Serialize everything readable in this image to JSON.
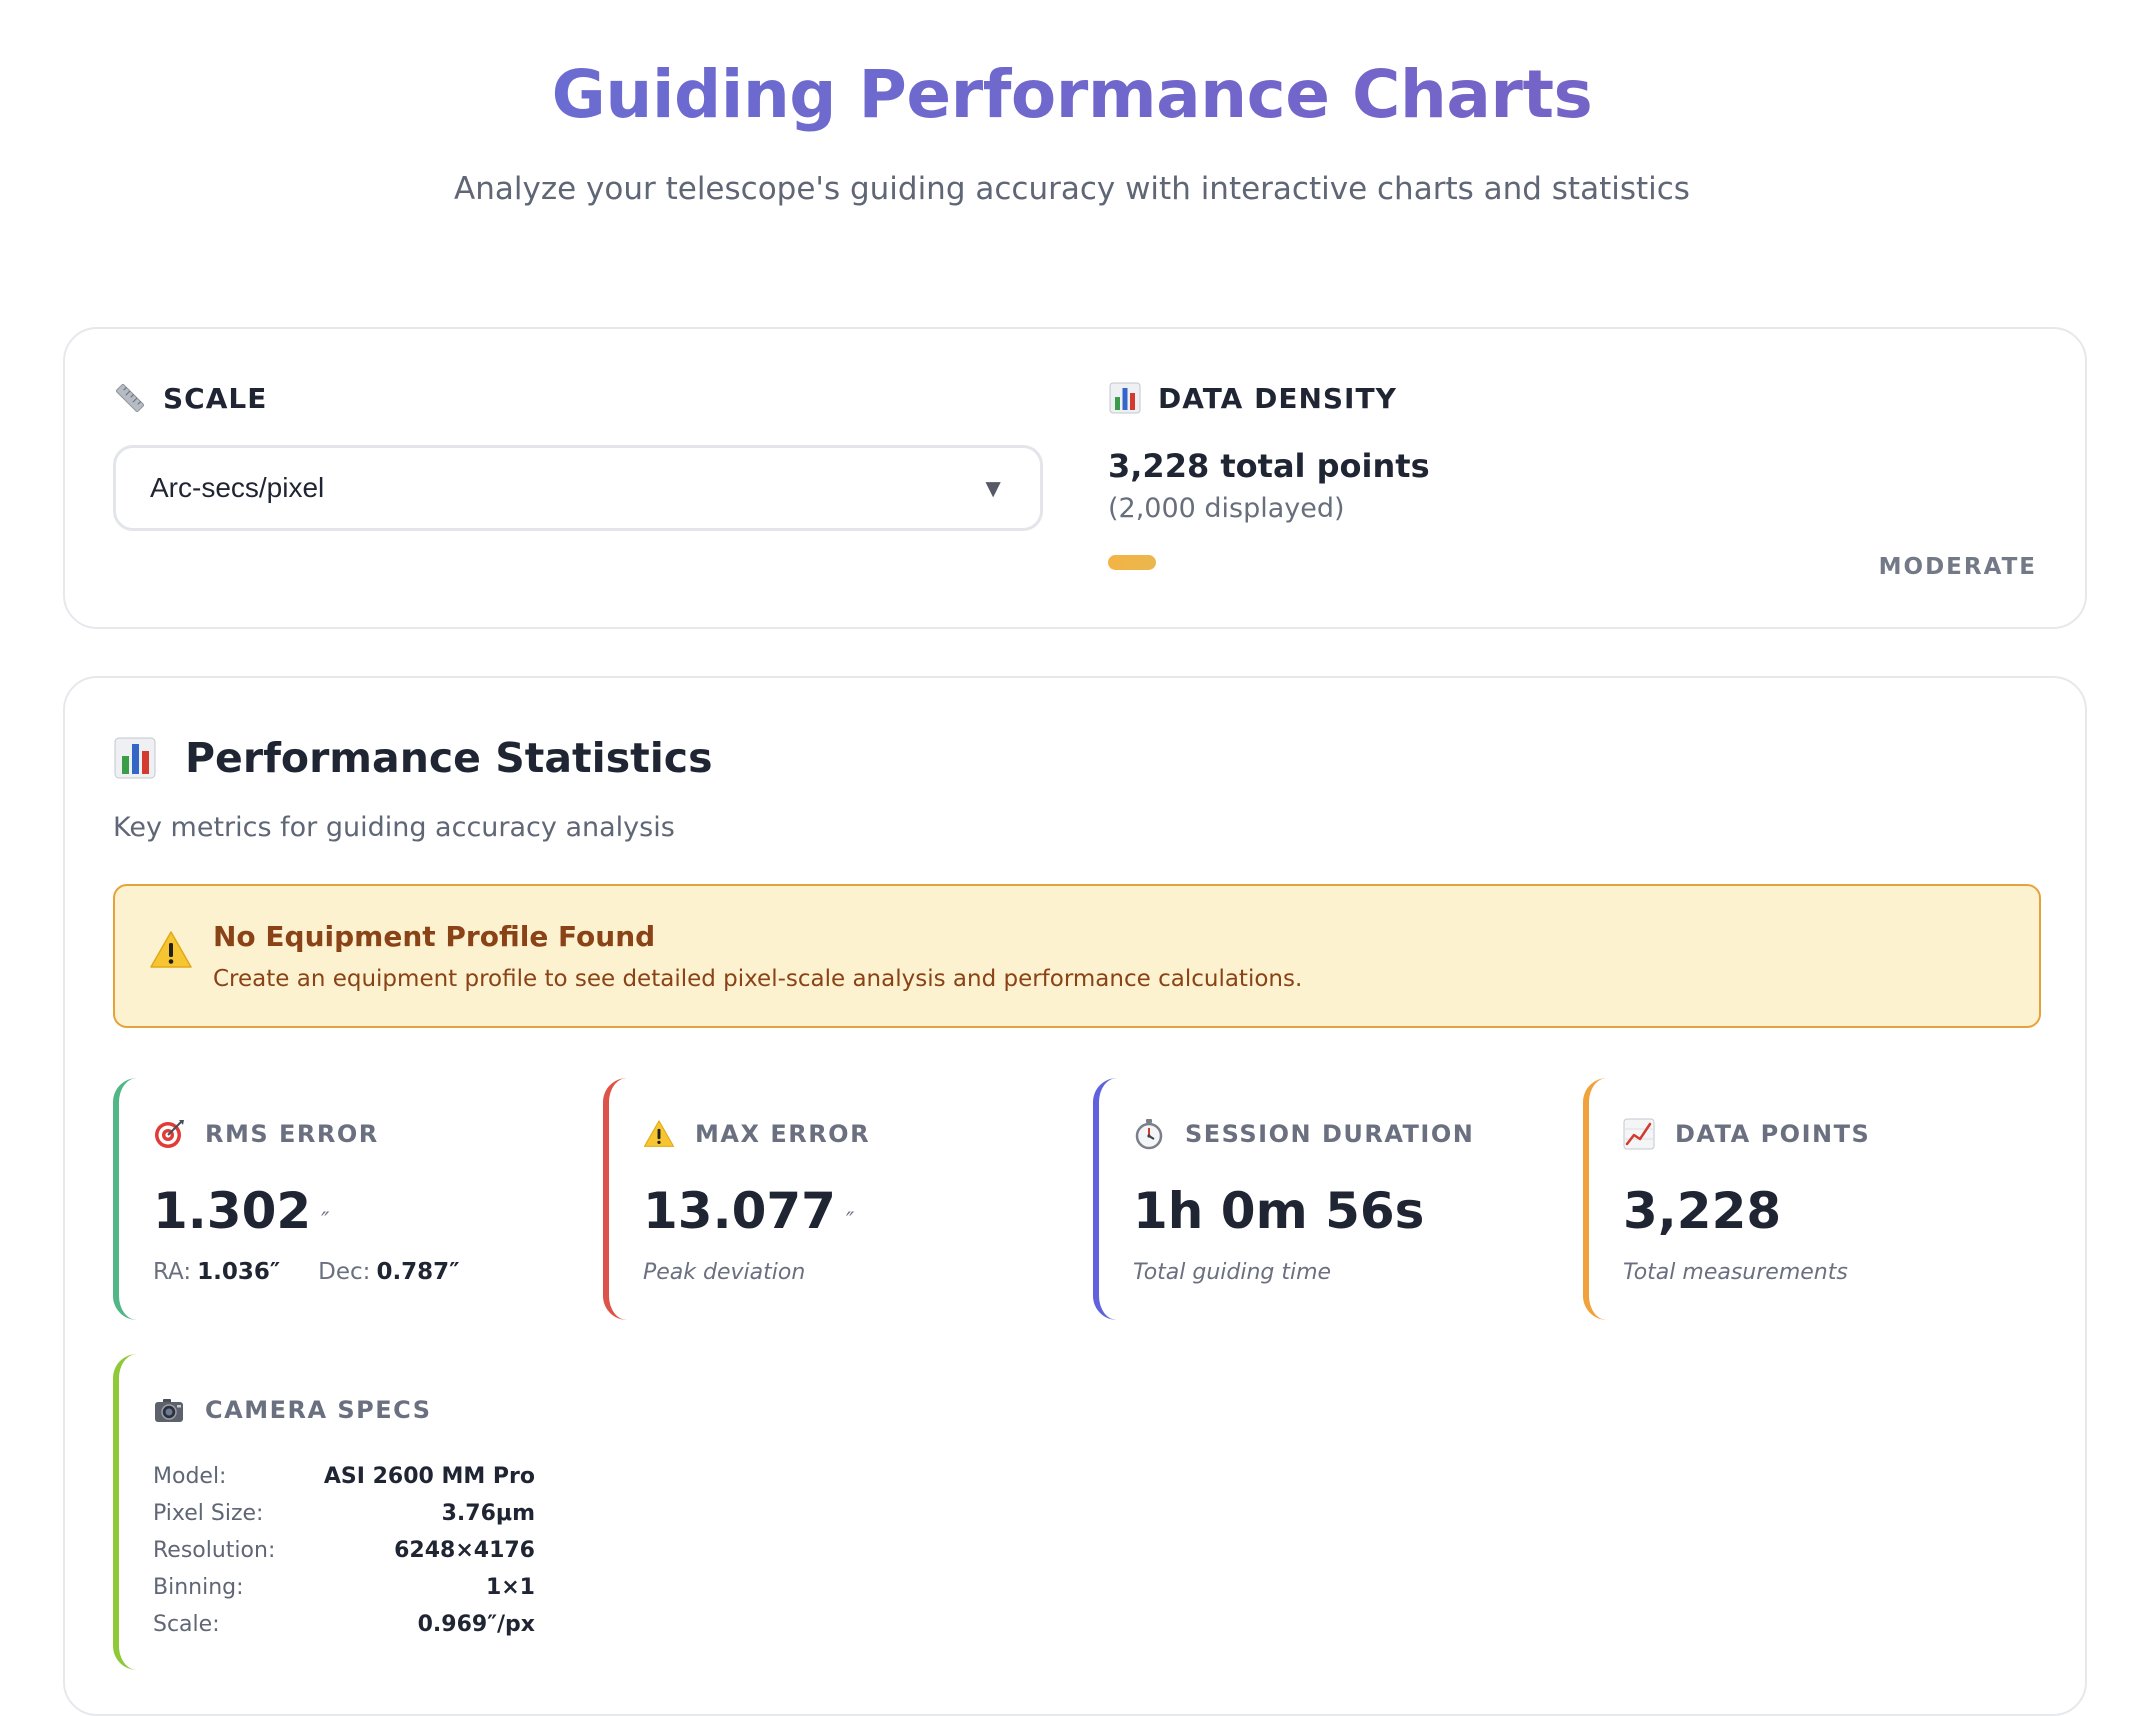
{
  "header": {
    "title": "Guiding Performance Charts",
    "subtitle": "Analyze your telescope's guiding accuracy with interactive charts and statistics"
  },
  "controls": {
    "scale": {
      "label": "SCALE",
      "icon": "ruler-icon",
      "selected": "Arc-secs/pixel"
    },
    "density": {
      "label": "DATA DENSITY",
      "icon": "bar-chart-icon",
      "total": "3,228 total points",
      "displayed": "(2,000 displayed)",
      "level": "MODERATE",
      "bar_color": "#f3b443"
    }
  },
  "stats": {
    "title": "Performance Statistics",
    "icon": "bar-chart-icon",
    "subtitle": "Key metrics for guiding accuracy analysis",
    "alert": {
      "icon": "warning-icon",
      "title": "No Equipment Profile Found",
      "text": "Create an equipment profile to see detailed pixel-scale analysis and performance calculations."
    },
    "rms": {
      "icon": "target-icon",
      "label": "RMS ERROR",
      "value": "1.302",
      "unit": "″",
      "ra_label": "RA:",
      "ra_value": "1.036″",
      "dec_label": "Dec:",
      "dec_value": "0.787″",
      "color": "#52b687"
    },
    "max": {
      "icon": "warning-icon",
      "label": "MAX ERROR",
      "value": "13.077",
      "unit": "″",
      "note": "Peak deviation",
      "color": "#de5349"
    },
    "session": {
      "icon": "stopwatch-icon",
      "label": "SESSION DURATION",
      "value": "1h 0m 56s",
      "note": "Total guiding time",
      "color": "#6263dc"
    },
    "points": {
      "icon": "trend-chart-icon",
      "label": "DATA POINTS",
      "value": "3,228",
      "note": "Total measurements",
      "color": "#f0a33c"
    },
    "camera": {
      "icon": "camera-icon",
      "label": "CAMERA SPECS",
      "color": "#8fc93a",
      "specs": [
        {
          "key": "Model:",
          "value": "ASI 2600 MM Pro"
        },
        {
          "key": "Pixel Size:",
          "value": "3.76μm"
        },
        {
          "key": "Resolution:",
          "value": "6248×4176"
        },
        {
          "key": "Binning:",
          "value": "1×1"
        },
        {
          "key": "Scale:",
          "value": "0.969″/px"
        }
      ]
    }
  }
}
